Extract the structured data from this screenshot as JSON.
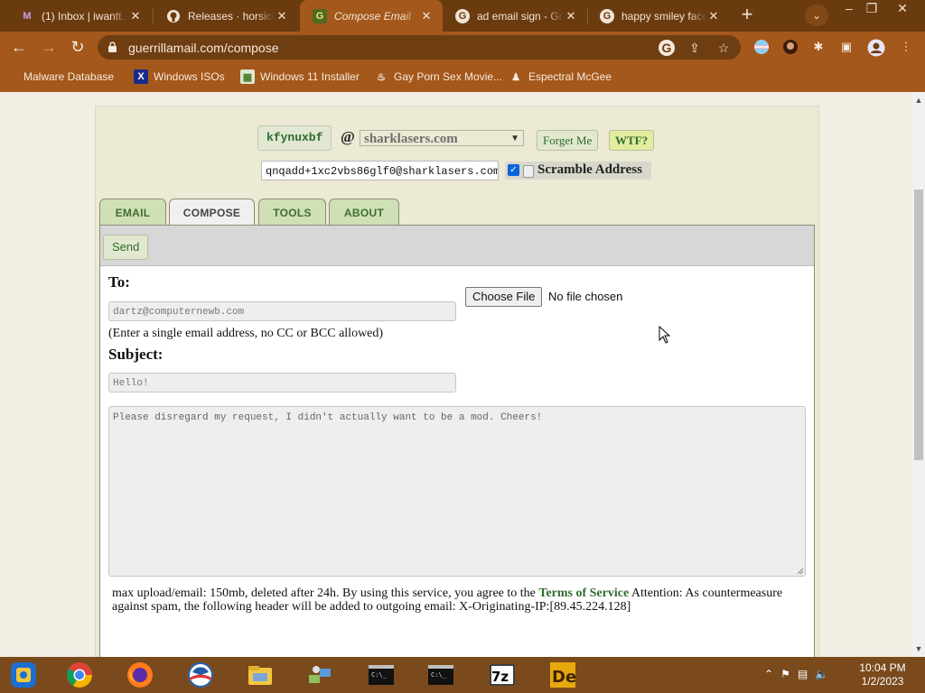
{
  "browser": {
    "tabs": [
      {
        "title": "(1) Inbox | iwantt...",
        "favicon": "gmail-icon"
      },
      {
        "title": "Releases · horsicq",
        "favicon": "github-icon"
      },
      {
        "title": "Compose Email",
        "favicon": "guerrilla-g-icon",
        "active": true
      },
      {
        "title": "ad email sign - Goo",
        "favicon": "google-icon"
      },
      {
        "title": "happy smiley face",
        "favicon": "google-icon"
      }
    ],
    "url": "guerrillamail.com/compose",
    "bookmarks": [
      {
        "label": "Malware Database",
        "icon": "malware-icon"
      },
      {
        "label": "Windows ISOs",
        "icon": "x-logo-icon"
      },
      {
        "label": "Windows 11 Installer",
        "icon": "image-icon"
      },
      {
        "label": "Gay Porn Sex Movie...",
        "icon": "site-icon"
      },
      {
        "label": "Espectral McGee",
        "icon": "figure-icon"
      }
    ]
  },
  "mail": {
    "username": "kfynuxbf",
    "at": "@",
    "domain": "sharklasers.com",
    "forget_label": "Forget Me",
    "wtf_label": "WTF?",
    "address": "qnqadd+1xc2vbs86glf0@sharklasers.com",
    "scramble_label": "Scramble Address",
    "scramble_checked": true,
    "tabs": [
      "EMAIL",
      "COMPOSE",
      "TOOLS",
      "ABOUT"
    ],
    "active_tab": "COMPOSE",
    "send_label": "Send",
    "to_label": "To:",
    "to_value": "dartz@computernewb.com",
    "to_note": "(Enter a single email address, no CC or BCC allowed)",
    "subject_label": "Subject:",
    "subject_value": "Hello!",
    "choose_file_label": "Choose File",
    "no_file_label": "No file chosen",
    "body_value": "Please disregard my request, I didn't actually want to be a mod. Cheers!",
    "foot_pre": "max upload/email: 150mb, deleted after 24h. By using this service, you agree to the ",
    "foot_link": "Terms of Service",
    "foot_post": " Attention: As countermeasure against spam, the following header will be added to outgoing email: X-Originating-IP:[89.45.224.128]"
  },
  "taskbar": {
    "time": "10:04 PM",
    "date": "1/2/2023",
    "apps": [
      "start-icon",
      "chrome-icon",
      "firefox-icon",
      "obama-logo-icon",
      "file-explorer-icon",
      "network-icon",
      "cmd-icon",
      "cmd-icon",
      "7zip-icon",
      "die-icon"
    ]
  },
  "colors": {
    "chrome_frame": "#6b3b10",
    "chrome_toolbar": "#a4581b",
    "accent_green": "#2e6b2e",
    "tab_green": "#cfe0b7"
  }
}
